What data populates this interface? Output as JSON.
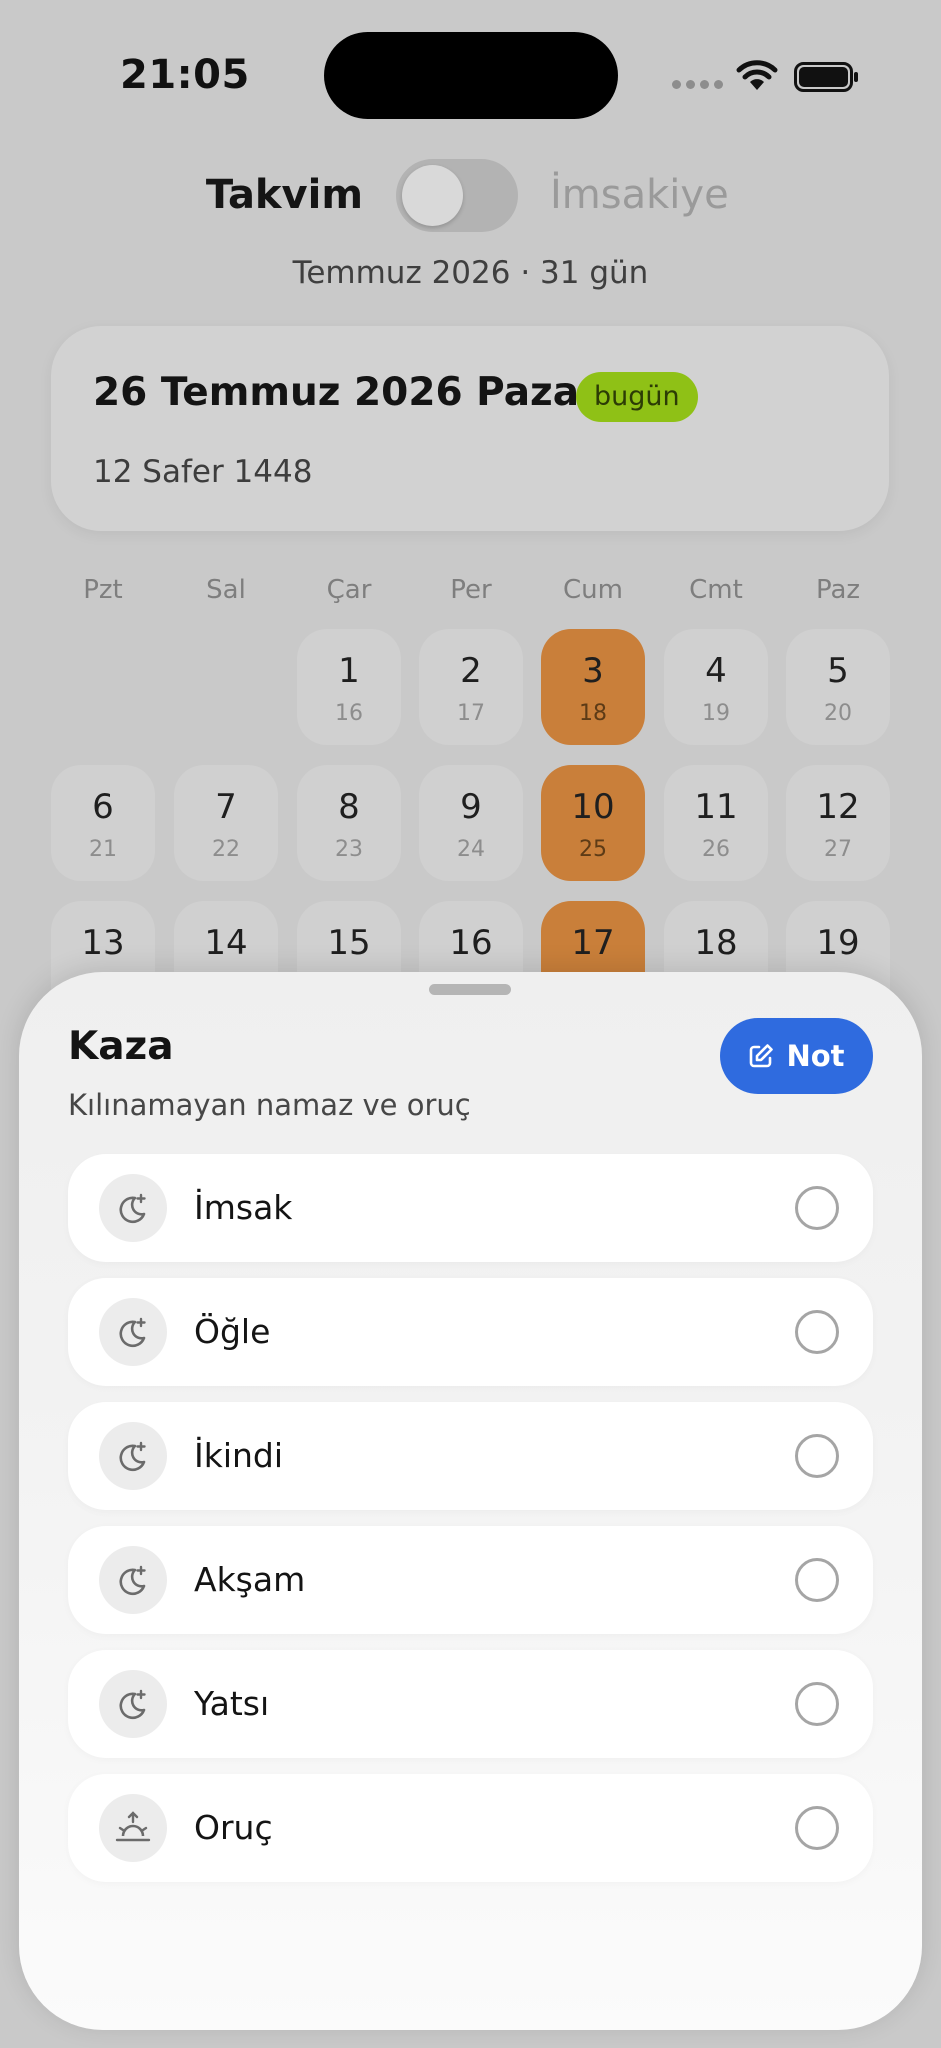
{
  "status": {
    "time": "21:05"
  },
  "header": {
    "left_label": "Takvim",
    "right_label": "İmsakiye",
    "month_summary": "Temmuz 2026 · 31 gün"
  },
  "date_card": {
    "title": "26 Temmuz 2026 Pazar",
    "badge": "bugün",
    "hijri": "12 Safer 1448"
  },
  "calendar": {
    "weekdays": [
      "Pzt",
      "Sal",
      "Çar",
      "Per",
      "Cum",
      "Cmt",
      "Paz"
    ],
    "days": [
      {
        "g": "1",
        "h": "16"
      },
      {
        "g": "2",
        "h": "17"
      },
      {
        "g": "3",
        "h": "18",
        "highlight": true
      },
      {
        "g": "4",
        "h": "19"
      },
      {
        "g": "5",
        "h": "20"
      },
      {
        "g": "6",
        "h": "21"
      },
      {
        "g": "7",
        "h": "22"
      },
      {
        "g": "8",
        "h": "23"
      },
      {
        "g": "9",
        "h": "24"
      },
      {
        "g": "10",
        "h": "25",
        "highlight": true
      },
      {
        "g": "11",
        "h": "26"
      },
      {
        "g": "12",
        "h": "27"
      },
      {
        "g": "13",
        "h": ""
      },
      {
        "g": "14",
        "h": ""
      },
      {
        "g": "15",
        "h": ""
      },
      {
        "g": "16",
        "h": ""
      },
      {
        "g": "17",
        "h": "",
        "highlight": true
      },
      {
        "g": "18",
        "h": ""
      },
      {
        "g": "19",
        "h": ""
      }
    ]
  },
  "sheet": {
    "title": "Kaza",
    "subtitle": "Kılınamayan namaz ve oruç",
    "note_button": "Not",
    "items": [
      {
        "label": "İmsak",
        "icon": "moon-star-icon"
      },
      {
        "label": "Öğle",
        "icon": "moon-star-icon"
      },
      {
        "label": "İkindi",
        "icon": "moon-star-icon"
      },
      {
        "label": "Akşam",
        "icon": "moon-star-icon"
      },
      {
        "label": "Yatsı",
        "icon": "moon-star-icon"
      },
      {
        "label": "Oruç",
        "icon": "sunrise-icon"
      }
    ]
  },
  "colors": {
    "highlight": "#c97f3a",
    "badge": "#8fc116",
    "accent_button": "#2f6bdf"
  }
}
